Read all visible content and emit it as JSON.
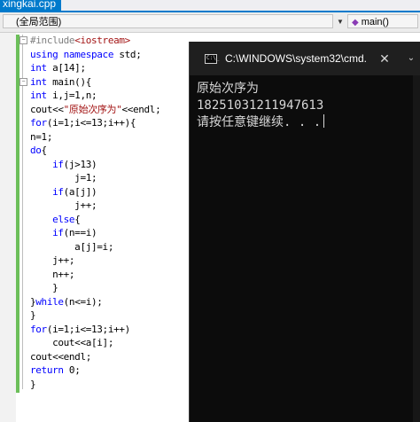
{
  "tab": {
    "filename": "xingkai.cpp"
  },
  "navbar": {
    "scope": "(全局范围)",
    "member": "main()"
  },
  "code_lines": [
    [
      {
        "t": "#include",
        "c": "pp"
      },
      {
        "t": "<iostream>",
        "c": "inc"
      }
    ],
    [
      {
        "t": "using ",
        "c": "kw"
      },
      {
        "t": "namespace ",
        "c": "kw"
      },
      {
        "t": "std;",
        "c": ""
      }
    ],
    [
      {
        "t": "int ",
        "c": "kw"
      },
      {
        "t": "a[14];",
        "c": ""
      }
    ],
    [
      {
        "t": "int ",
        "c": "kw"
      },
      {
        "t": "main(){",
        "c": ""
      }
    ],
    [
      {
        "t": "int ",
        "c": "kw"
      },
      {
        "t": "i,j=1,n;",
        "c": ""
      }
    ],
    [
      {
        "t": "cout<<",
        "c": ""
      },
      {
        "t": "\"原始次序为\"",
        "c": "str"
      },
      {
        "t": "<<endl;",
        "c": ""
      }
    ],
    [
      {
        "t": "for",
        "c": "kw"
      },
      {
        "t": "(i=1;i<=13;i++){",
        "c": ""
      }
    ],
    [
      {
        "t": "n=1;",
        "c": ""
      }
    ],
    [
      {
        "t": "do",
        "c": "kw"
      },
      {
        "t": "{",
        "c": ""
      }
    ],
    [
      {
        "t": "    if",
        "c": "kw"
      },
      {
        "t": "(j>13)",
        "c": ""
      }
    ],
    [
      {
        "t": "        j=1;",
        "c": ""
      }
    ],
    [
      {
        "t": "    if",
        "c": "kw"
      },
      {
        "t": "(a[j])",
        "c": ""
      }
    ],
    [
      {
        "t": "        j++;",
        "c": ""
      }
    ],
    [
      {
        "t": "    else",
        "c": "kw"
      },
      {
        "t": "{",
        "c": ""
      }
    ],
    [
      {
        "t": "    if",
        "c": "kw"
      },
      {
        "t": "(n==i)",
        "c": ""
      }
    ],
    [
      {
        "t": "        a[j]=i;",
        "c": ""
      }
    ],
    [
      {
        "t": "    j++;",
        "c": ""
      }
    ],
    [
      {
        "t": "    n++;",
        "c": ""
      }
    ],
    [
      {
        "t": "    }",
        "c": ""
      }
    ],
    [
      {
        "t": "}",
        "c": ""
      },
      {
        "t": "while",
        "c": "kw"
      },
      {
        "t": "(n<=i);",
        "c": ""
      }
    ],
    [
      {
        "t": "}",
        "c": ""
      }
    ],
    [
      {
        "t": "for",
        "c": "kw"
      },
      {
        "t": "(i=1;i<=13;i++)",
        "c": ""
      }
    ],
    [
      {
        "t": "    cout<<a[i];",
        "c": ""
      }
    ],
    [
      {
        "t": "cout<<endl;",
        "c": ""
      }
    ],
    [
      {
        "t": "return ",
        "c": "kw"
      },
      {
        "t": "0;",
        "c": ""
      }
    ],
    [
      {
        "t": "}",
        "c": ""
      }
    ]
  ],
  "console": {
    "title": "C:\\WINDOWS\\system32\\cmd.",
    "icon_text": "C:\\_",
    "lines": [
      "原始次序为",
      "1825103121194​7613",
      "请按任意键继续. . ."
    ],
    "close_glyph": "✕",
    "menu_glyph": "⌄"
  },
  "icons": [
    "collapse-icon",
    "method-icon",
    "console-icon",
    "close-icon",
    "dropdown-icon"
  ],
  "colors": {
    "accent": "#007acc",
    "keyword": "#0000ff",
    "string": "#a31515",
    "change_bar": "#6cbf5a",
    "console_bg": "#0c0c0c"
  }
}
